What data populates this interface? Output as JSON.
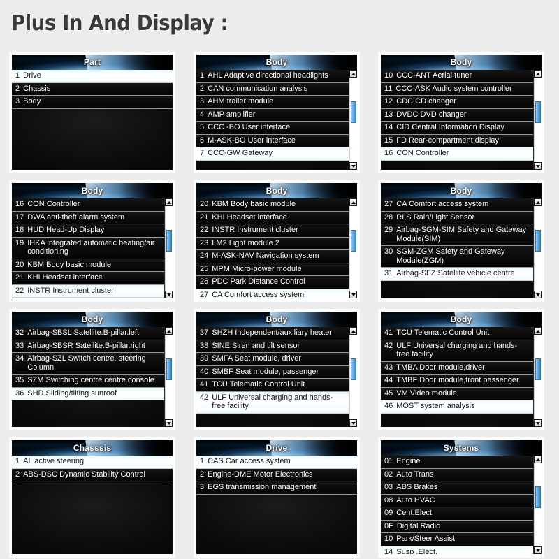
{
  "page": {
    "title": "Plus In And Display :",
    "background_color": "#ececec",
    "title_color": "#3a3a3a",
    "accent_color": "#5ba8e0",
    "selected_row_color": "#eaf9ff"
  },
  "panels": [
    {
      "header": "Part",
      "scrollbar": false,
      "rows": [
        {
          "index": "1",
          "text": "Drive",
          "selected": true
        },
        {
          "index": "2",
          "text": "Chassis",
          "selected": false
        },
        {
          "index": "3",
          "text": "Body",
          "selected": false
        }
      ]
    },
    {
      "header": "Body",
      "scrollbar": true,
      "rows": [
        {
          "index": "1",
          "text": "AHL Adaptive directional headlights",
          "selected": false
        },
        {
          "index": "2",
          "text": "CAN communication analysis",
          "selected": false
        },
        {
          "index": "3",
          "text": "AHM trailer module",
          "selected": false
        },
        {
          "index": "4",
          "text": "AMP amplifier",
          "selected": false
        },
        {
          "index": "5",
          "text": "CCC -BO User interface",
          "selected": false
        },
        {
          "index": "6",
          "text": "M-ASK-BO User interface",
          "selected": false
        },
        {
          "index": "7",
          "text": "CCC-GW Gateway",
          "selected": true
        }
      ]
    },
    {
      "header": "Body",
      "scrollbar": true,
      "rows": [
        {
          "index": "10",
          "text": "CCC-ANT Aerial tuner",
          "selected": false
        },
        {
          "index": "11",
          "text": "CCC-ASK Audio system controller",
          "selected": false
        },
        {
          "index": "12",
          "text": "CDC CD changer",
          "selected": false
        },
        {
          "index": "13",
          "text": "DVDC DVD changer",
          "selected": false
        },
        {
          "index": "14",
          "text": "CID Central Information Display",
          "selected": false
        },
        {
          "index": "15",
          "text": "FD Rear-compartment display",
          "selected": false
        },
        {
          "index": "16",
          "text": "CON Controller",
          "selected": true
        }
      ]
    },
    {
      "header": "Body",
      "scrollbar": true,
      "rows": [
        {
          "index": "16",
          "text": "CON Controller",
          "selected": false
        },
        {
          "index": "17",
          "text": "DWA anti-theft alarm system",
          "selected": false
        },
        {
          "index": "18",
          "text": "HUD Head-Up Display",
          "selected": false
        },
        {
          "index": "19",
          "text": "IHKA integrated automatic heating/air conditioning",
          "selected": false
        },
        {
          "index": "20",
          "text": "KBM Body basic module",
          "selected": false
        },
        {
          "index": "21",
          "text": "KHI Headset interface",
          "selected": false
        },
        {
          "index": "22",
          "text": "INSTR Instrument cluster",
          "selected": true
        }
      ]
    },
    {
      "header": "Body",
      "scrollbar": true,
      "rows": [
        {
          "index": "20",
          "text": "KBM Body basic module",
          "selected": false
        },
        {
          "index": "21",
          "text": "KHI Headset interface",
          "selected": false
        },
        {
          "index": "22",
          "text": "INSTR Instrument cluster",
          "selected": false
        },
        {
          "index": "23",
          "text": "LM2 Light module 2",
          "selected": false
        },
        {
          "index": "24",
          "text": " M-ASK-NAV Navigation system",
          "selected": false
        },
        {
          "index": "25",
          "text": " MPM Micro-power module",
          "selected": false
        },
        {
          "index": "26",
          "text": " PDC Park Distance Control",
          "selected": false
        },
        {
          "index": "27",
          "text": "CA Comfort access system",
          "selected": true
        }
      ]
    },
    {
      "header": "Body",
      "scrollbar": true,
      "rows": [
        {
          "index": "27",
          "text": "CA Comfort access system",
          "selected": false
        },
        {
          "index": "28",
          "text": "RLS Rain/Light Sensor",
          "selected": false
        },
        {
          "index": "29",
          "text": "Airbag-SGM-SIM Safety and Gateway Module(SIM)",
          "selected": false
        },
        {
          "index": "30",
          "text": "SGM-ZGM Safety and Gateway Module(ZGM)",
          "selected": false
        },
        {
          "index": "31",
          "text": "Airbag-SFZ Satellite vehicle centre",
          "selected": true
        }
      ]
    },
    {
      "header": "Body",
      "scrollbar": true,
      "rows": [
        {
          "index": "32",
          "text": "Airbag-SBSL Satellite.B-pillar.left",
          "selected": false
        },
        {
          "index": "33",
          "text": "Airbag-SBSR Satellite.B-pillar.right",
          "selected": false
        },
        {
          "index": "34",
          "text": "Airbag-SZL Switch centre. steering Column",
          "selected": false
        },
        {
          "index": "35",
          "text": "SZM Switching centre.centre console",
          "selected": false
        },
        {
          "index": "36",
          "text": "SHD Sliding/tilting sunroof",
          "selected": true
        }
      ]
    },
    {
      "header": "Body",
      "scrollbar": true,
      "rows": [
        {
          "index": "37",
          "text": "SHZH Independent/auxiliary heater",
          "selected": false
        },
        {
          "index": "38",
          "text": "SINE Siren and tilt sensor",
          "selected": false
        },
        {
          "index": "39",
          "text": "SMFA  Seat module, driver",
          "selected": false
        },
        {
          "index": "40",
          "text": "SMBF  Seat module, passenger",
          "selected": false
        },
        {
          "index": "41",
          "text": "TCU Telematic Control Unit",
          "selected": false
        },
        {
          "index": "42",
          "text": "ULF Universal charging and hands-free facility",
          "selected": true
        }
      ]
    },
    {
      "header": "Body",
      "scrollbar": true,
      "rows": [
        {
          "index": "41",
          "text": "TCU Telematic Control Unit",
          "selected": false
        },
        {
          "index": "42",
          "text": "ULF  Universal charging and hands-free facility",
          "selected": false
        },
        {
          "index": "43",
          "text": "TMBA Door module,driver",
          "selected": false
        },
        {
          "index": "44",
          "text": "TMBF  Door module,front passenger",
          "selected": false
        },
        {
          "index": "45",
          "text": "VM Video module",
          "selected": false
        },
        {
          "index": "46",
          "text": "MOST system analysis",
          "selected": true
        }
      ]
    },
    {
      "header": "Chasssis",
      "scrollbar": false,
      "rows": [
        {
          "index": "1",
          "text": "AL active steering",
          "selected": true
        },
        {
          "index": "2",
          "text": "ABS-DSC Dynamic Stability Control",
          "selected": false
        }
      ]
    },
    {
      "header": "Drive",
      "scrollbar": false,
      "rows": [
        {
          "index": "1",
          "text": "CAS Car access system",
          "selected": true
        },
        {
          "index": "2",
          "text": "Engine-DME Motor Electronics",
          "selected": false
        },
        {
          "index": "3",
          "text": "EGS transmission management",
          "selected": false
        }
      ]
    },
    {
      "header": "Systems",
      "scrollbar": true,
      "rows": [
        {
          "index": "01",
          "text": "Engine",
          "selected": false
        },
        {
          "index": "02",
          "text": "Auto Trans",
          "selected": false
        },
        {
          "index": "03",
          "text": "ABS Brakes",
          "selected": false
        },
        {
          "index": "08",
          "text": "Auto HVAC",
          "selected": false
        },
        {
          "index": "09",
          "text": "Cent.Elect",
          "selected": false
        },
        {
          "index": "0F",
          "text": " Digital Radio",
          "selected": false
        },
        {
          "index": "10",
          "text": " Park/Steer Assist",
          "selected": false
        },
        {
          "index": "14",
          "text": "Susp .Elect.",
          "selected": true
        }
      ]
    }
  ]
}
